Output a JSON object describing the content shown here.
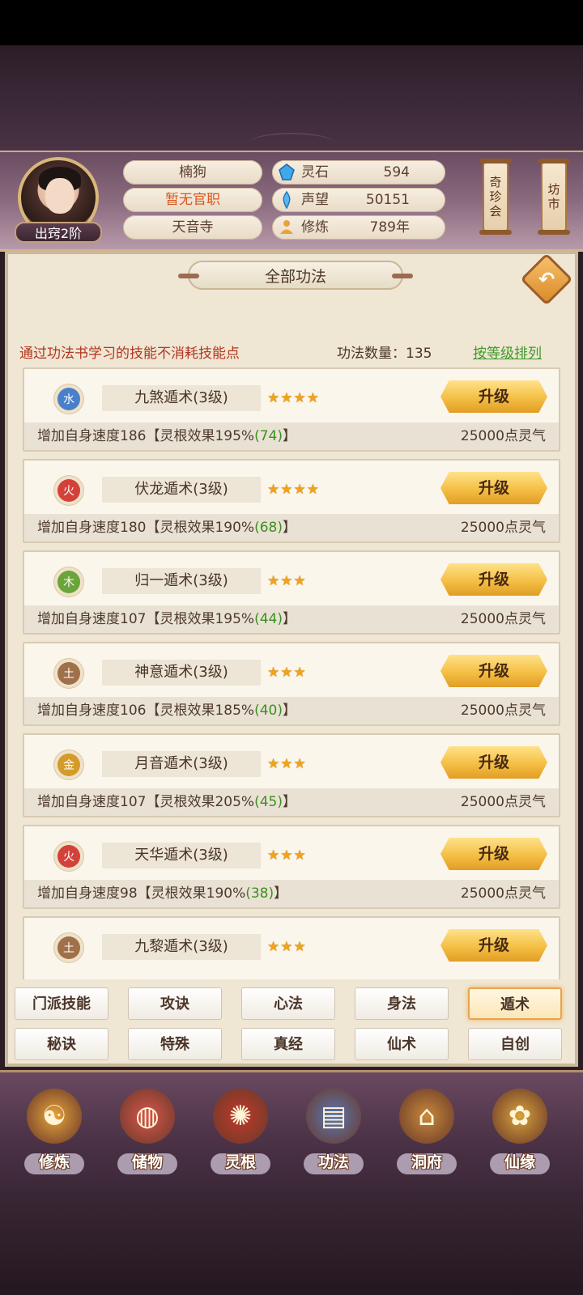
{
  "header": {
    "name": "楠狗",
    "official_title": "暂无官职",
    "sect": "天音寺",
    "rank": "出窍2阶",
    "stats": [
      {
        "icon": "spirit-stone-icon",
        "label": "灵石",
        "value": "594"
      },
      {
        "icon": "reputation-icon",
        "label": "声望",
        "value": "50151"
      },
      {
        "icon": "cultivation-icon",
        "label": "修炼",
        "value": "789年"
      }
    ],
    "side_buttons": [
      "奇珍会",
      "坊市"
    ]
  },
  "panel": {
    "title": "全部功法",
    "notice": "通过功法书学习的技能不消耗技能点",
    "count_label": "功法数量：135",
    "sort_label": "按等级排列",
    "upgrade_label": "升级"
  },
  "skills": [
    {
      "element": "水",
      "color": "#4a7fc9",
      "name": "九煞遁术(3级)",
      "stars": "★★★★",
      "desc": "增加自身速度186【灵根效果195%",
      "effect": "(74)",
      "desc_end": "】",
      "cost": "25000点灵气"
    },
    {
      "element": "火",
      "color": "#d3423a",
      "name": "伏龙遁术(3级)",
      "stars": "★★★★",
      "desc": "增加自身速度180【灵根效果190%",
      "effect": "(68)",
      "desc_end": "】",
      "cost": "25000点灵气"
    },
    {
      "element": "木",
      "color": "#6aa53a",
      "name": "归一遁术(3级)",
      "stars": "★★★",
      "desc": "增加自身速度107【灵根效果195%",
      "effect": "(44)",
      "desc_end": "】",
      "cost": "25000点灵气"
    },
    {
      "element": "土",
      "color": "#a0704a",
      "name": "神意遁术(3级)",
      "stars": "★★★",
      "desc": "增加自身速度106【灵根效果185%",
      "effect": "(40)",
      "desc_end": "】",
      "cost": "25000点灵气"
    },
    {
      "element": "金",
      "color": "#d49a2a",
      "name": "月音遁术(3级)",
      "stars": "★★★",
      "desc": "增加自身速度107【灵根效果205%",
      "effect": "(45)",
      "desc_end": "】",
      "cost": "25000点灵气"
    },
    {
      "element": "火",
      "color": "#d3423a",
      "name": "天华遁术(3级)",
      "stars": "★★★",
      "desc": "增加自身速度98【灵根效果190%",
      "effect": "(38)",
      "desc_end": "】",
      "cost": "25000点灵气"
    },
    {
      "element": "土",
      "color": "#a0704a",
      "name": "九黎遁术(3级)",
      "stars": "★★★",
      "desc": "",
      "effect": "",
      "desc_end": "",
      "cost": ""
    }
  ],
  "tabs": [
    [
      "门派技能",
      "攻诀",
      "心法",
      "身法",
      "遁术"
    ],
    [
      "秘诀",
      "特殊",
      "真经",
      "仙术",
      "自创"
    ]
  ],
  "active_tab": "遁术",
  "bottom_nav": [
    {
      "label": "修炼",
      "icon": "cultivate-icon"
    },
    {
      "label": "储物",
      "icon": "storage-bag-icon"
    },
    {
      "label": "灵根",
      "icon": "spirit-root-icon"
    },
    {
      "label": "功法",
      "icon": "skill-book-icon"
    },
    {
      "label": "洞府",
      "icon": "cave-house-icon"
    },
    {
      "label": "仙缘",
      "icon": "fortune-gourd-icon"
    }
  ]
}
